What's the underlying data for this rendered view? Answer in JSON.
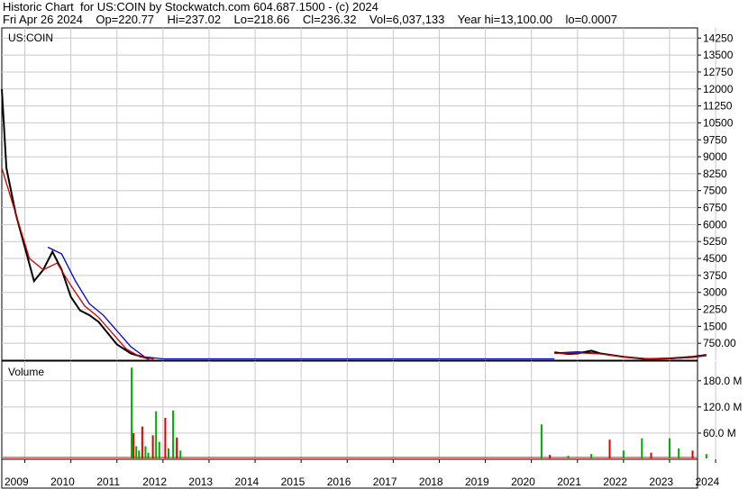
{
  "header": {
    "line1": "Historic Chart  for US:COIN by Stockwatch.com 604.687.1500 - (c) 2024",
    "line2": "Fri Apr 26 2024    Op=220.77    Hi=237.02    Lo=218.66    Cl=236.32    Vol=6,037,133    Year hi=13,100.00    lo=0.0007"
  },
  "chart_data": [
    {
      "type": "line",
      "title": "US:COIN",
      "symbol": "US:COIN",
      "ylim": [
        0,
        14700
      ],
      "y_ticks": [
        750,
        1500,
        2250,
        3000,
        3750,
        4500,
        5250,
        6000,
        6750,
        7500,
        8250,
        9000,
        9750,
        10500,
        11250,
        12000,
        12750,
        13500,
        14250
      ],
      "y_tick_labels": [
        "750.00",
        "1500",
        "2250",
        "3000",
        "3750",
        "4500",
        "5250",
        "6000",
        "6750",
        "7500",
        "8250",
        "9000",
        "9750",
        "10500",
        "11250",
        "12000",
        "12750",
        "13500",
        "14250"
      ],
      "x_ticks": [
        "2009",
        "2010",
        "2011",
        "2012",
        "2013",
        "2014",
        "2015",
        "2016",
        "2017",
        "2018",
        "2019",
        "2020",
        "2021",
        "2022",
        "2023",
        "2024"
      ],
      "grid": true,
      "colors": {
        "price": "#000000",
        "ma_short": "#cc0000",
        "ma_long": "#0000cc",
        "ma_mid": "#cc00cc"
      },
      "series": [
        {
          "role": "price",
          "x": [
            2009.0,
            2009.1,
            2009.3,
            2009.5,
            2009.7,
            2009.9,
            2010.1,
            2010.3,
            2010.5,
            2010.7,
            2010.9,
            2011.1,
            2011.3,
            2011.5,
            2011.8,
            2012.2,
            2021.0,
            2021.3,
            2021.5,
            2021.8,
            2022.0,
            2022.5,
            2023.0,
            2023.5,
            2024.0,
            2024.3
          ],
          "values": [
            12000,
            8500,
            6500,
            5000,
            3500,
            4000,
            4800,
            4000,
            2800,
            2200,
            2000,
            1700,
            1200,
            700,
            300,
            60,
            350,
            280,
            300,
            420,
            300,
            150,
            50,
            80,
            150,
            236
          ]
        },
        {
          "role": "ma_short",
          "x": [
            2009.0,
            2009.3,
            2009.6,
            2009.9,
            2010.2,
            2010.5,
            2010.8,
            2011.1,
            2011.4,
            2011.7,
            2012.0,
            2012.3,
            2021.0,
            2021.5,
            2022.0,
            2022.5,
            2023.0,
            2023.5,
            2024.0,
            2024.3
          ],
          "values": [
            8500,
            6500,
            4500,
            4000,
            4300,
            3300,
            2400,
            1900,
            1200,
            500,
            150,
            50,
            300,
            330,
            280,
            140,
            60,
            70,
            130,
            220
          ]
        },
        {
          "role": "ma_long",
          "x": [
            2010.0,
            2010.3,
            2010.6,
            2010.9,
            2011.2,
            2011.5,
            2011.8,
            2012.1,
            2012.5,
            2021.0,
            2021.5,
            2022.0,
            2022.5,
            2023.0,
            2023.5,
            2024.0,
            2024.3
          ],
          "values": [
            5000,
            4700,
            3500,
            2500,
            2000,
            1300,
            600,
            150,
            60,
            320,
            370,
            300,
            150,
            70,
            65,
            120,
            200
          ]
        }
      ]
    },
    {
      "type": "bar",
      "title": "Volume",
      "ylim": [
        0,
        225
      ],
      "y_ticks": [
        60,
        120,
        180
      ],
      "y_tick_labels": [
        "60.0 M",
        "120.0 M",
        "180.0 M"
      ],
      "colors": {
        "up": "#00aa00",
        "down": "#dd0000"
      },
      "bars": [
        {
          "x": 2011.82,
          "value": 210
        },
        {
          "x": 2011.86,
          "value": 60
        },
        {
          "x": 2011.92,
          "value": 30
        },
        {
          "x": 2011.98,
          "value": 20
        },
        {
          "x": 2012.05,
          "value": 75
        },
        {
          "x": 2012.12,
          "value": 30
        },
        {
          "x": 2012.18,
          "value": 15
        },
        {
          "x": 2012.28,
          "value": 55
        },
        {
          "x": 2012.35,
          "value": 110
        },
        {
          "x": 2012.42,
          "value": 40
        },
        {
          "x": 2012.55,
          "value": 95
        },
        {
          "x": 2012.62,
          "value": 25
        },
        {
          "x": 2012.72,
          "value": 112
        },
        {
          "x": 2012.8,
          "value": 50
        },
        {
          "x": 2012.88,
          "value": 20
        },
        {
          "x": 2020.72,
          "value": 80
        },
        {
          "x": 2020.9,
          "value": 10
        },
        {
          "x": 2021.3,
          "value": 8
        },
        {
          "x": 2021.8,
          "value": 12
        },
        {
          "x": 2022.2,
          "value": 45
        },
        {
          "x": 2022.5,
          "value": 20
        },
        {
          "x": 2022.9,
          "value": 48
        },
        {
          "x": 2023.1,
          "value": 15
        },
        {
          "x": 2023.5,
          "value": 48
        },
        {
          "x": 2023.7,
          "value": 25
        },
        {
          "x": 2024.0,
          "value": 20
        },
        {
          "x": 2024.3,
          "value": 12
        }
      ]
    }
  ]
}
